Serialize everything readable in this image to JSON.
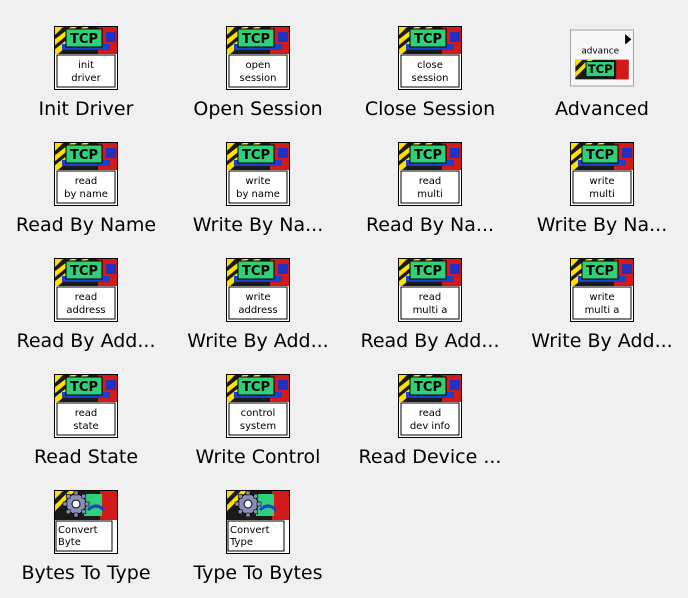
{
  "palette": {
    "items": [
      {
        "label": "Init Driver",
        "icon_kind": "tcp",
        "icon_lines": [
          "init",
          "driver"
        ]
      },
      {
        "label": "Open Session",
        "icon_kind": "tcp",
        "icon_lines": [
          "open",
          "session"
        ]
      },
      {
        "label": "Close Session",
        "icon_kind": "tcp",
        "icon_lines": [
          "close",
          "session"
        ]
      },
      {
        "label": "Advanced",
        "icon_kind": "advanced",
        "icon_lines": [
          "advance",
          "TCP"
        ]
      },
      {
        "label": "Read By Name",
        "icon_kind": "tcp",
        "icon_lines": [
          "read",
          "by name"
        ]
      },
      {
        "label": "Write By Na...",
        "icon_kind": "tcp",
        "icon_lines": [
          "write",
          "by name"
        ]
      },
      {
        "label": "Read By Na...",
        "icon_kind": "tcp",
        "icon_lines": [
          "read",
          "multi"
        ]
      },
      {
        "label": "Write By Na...",
        "icon_kind": "tcp",
        "icon_lines": [
          "write",
          "multi"
        ]
      },
      {
        "label": "Read By Add...",
        "icon_kind": "tcp",
        "icon_lines": [
          "read",
          "address"
        ]
      },
      {
        "label": "Write By Add...",
        "icon_kind": "tcp",
        "icon_lines": [
          "write",
          "address"
        ]
      },
      {
        "label": "Read By Add...",
        "icon_kind": "tcp",
        "icon_lines": [
          "read",
          "multi a"
        ]
      },
      {
        "label": "Write By Add...",
        "icon_kind": "tcp",
        "icon_lines": [
          "write",
          "multi a"
        ]
      },
      {
        "label": "Read State",
        "icon_kind": "tcp",
        "icon_lines": [
          "read",
          "state"
        ]
      },
      {
        "label": "Write Control",
        "icon_kind": "tcp",
        "icon_lines": [
          "control",
          "system"
        ]
      },
      {
        "label": "Read Device ...",
        "icon_kind": "tcp",
        "icon_lines": [
          "read",
          "dev info"
        ]
      },
      {
        "label": "Bytes To Type",
        "icon_kind": "convert",
        "icon_lines": [
          "Convert",
          "Byte"
        ]
      },
      {
        "label": "Type To Bytes",
        "icon_kind": "convert",
        "icon_lines": [
          "Convert",
          "Type"
        ]
      }
    ],
    "tcp_badge": "TCP"
  }
}
